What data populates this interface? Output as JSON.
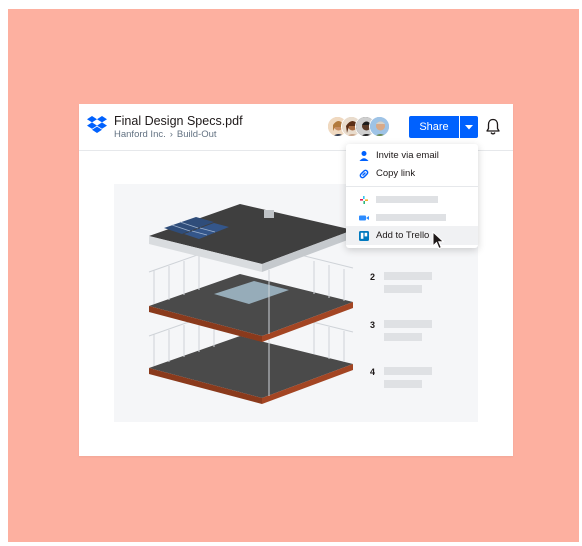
{
  "colors": {
    "backdrop": "#fdb0a0",
    "accent": "#0061fe",
    "text": "#1e1919",
    "muted": "#637282",
    "placeholder": "#dfe1e4"
  },
  "header": {
    "logo_icon": "dropbox-logo",
    "file_name": "Final Design Specs.pdf",
    "breadcrumb": [
      "Hanford Inc.",
      "Build-Out"
    ],
    "breadcrumb_separator": "›",
    "avatars_count": 4,
    "share_label": "Share",
    "share_dropdown_icon": "caret-down-icon",
    "notifications_icon": "bell-icon"
  },
  "share_menu": {
    "items": [
      {
        "icon": "person-icon",
        "label": "Invite via email"
      },
      {
        "icon": "link-icon",
        "label": "Copy link"
      },
      {
        "icon": "slack-icon",
        "label": ""
      },
      {
        "icon": "zoom-video-icon",
        "label": ""
      },
      {
        "icon": "trello-icon",
        "label": "Add to Trello"
      }
    ],
    "hovered": "Add to Trello"
  },
  "document": {
    "list_numbers": [
      "2",
      "3",
      "4"
    ]
  }
}
